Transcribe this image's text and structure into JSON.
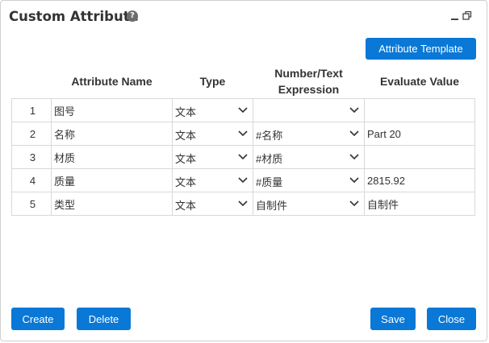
{
  "dialog": {
    "title": "Custom Attribute",
    "help_glyph": "?"
  },
  "toolbar": {
    "template_label": "Attribute Template"
  },
  "table": {
    "headers": {
      "index": "",
      "name": "Attribute Name",
      "type": "Type",
      "expression": "Number/Text Expression",
      "value": "Evaluate Value"
    },
    "rows": [
      {
        "index": "1",
        "name": "图号",
        "type": "文本",
        "expression": "",
        "value": ""
      },
      {
        "index": "2",
        "name": "名称",
        "type": "文本",
        "expression": "#名称",
        "value": "Part 20"
      },
      {
        "index": "3",
        "name": "材质",
        "type": "文本",
        "expression": "#材质",
        "value": ""
      },
      {
        "index": "4",
        "name": "质量",
        "type": "文本",
        "expression": "#质量",
        "value": "2815.92"
      },
      {
        "index": "5",
        "name": "类型",
        "type": "文本",
        "expression": "自制件",
        "value": "自制件"
      }
    ]
  },
  "footer": {
    "create_label": "Create",
    "delete_label": "Delete",
    "save_label": "Save",
    "close_label": "Close"
  },
  "colors": {
    "accent": "#0a78d6",
    "border": "#d9d9d9"
  }
}
